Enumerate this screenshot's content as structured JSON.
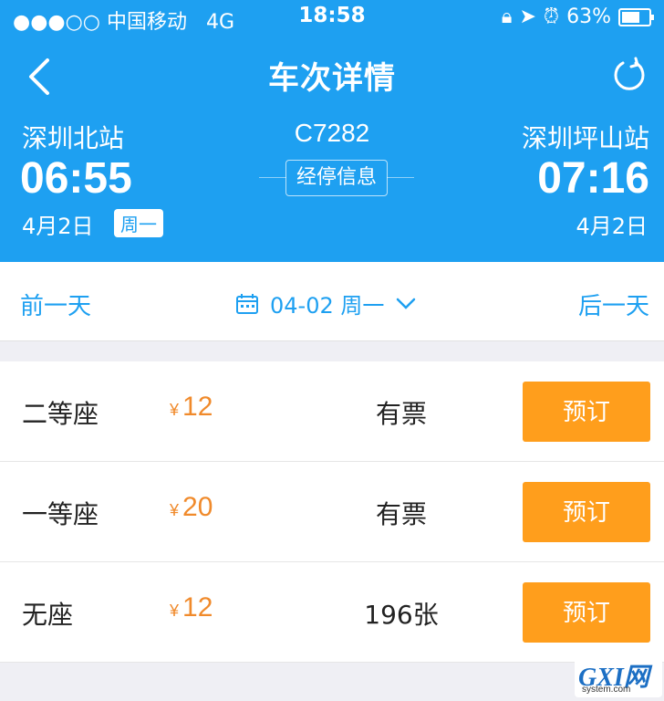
{
  "status_bar": {
    "carrier": "●●●○○ 中国移动",
    "network": "4G",
    "time": "18:58",
    "battery": "63%"
  },
  "nav": {
    "title": "车次详情"
  },
  "train": {
    "number": "C7282",
    "stops_label": "经停信息",
    "from": {
      "station": "深圳北站",
      "time": "06:55",
      "date": "4月2日",
      "weekday": "周一"
    },
    "to": {
      "station": "深圳坪山站",
      "time": "07:16",
      "date": "4月2日"
    }
  },
  "date_bar": {
    "prev": "前一天",
    "date": "04-02 周一",
    "next": "后一天"
  },
  "seats": [
    {
      "type": "二等座",
      "currency": "¥",
      "price": "12",
      "availability": "有票",
      "action": "预订"
    },
    {
      "type": "一等座",
      "currency": "¥",
      "price": "20",
      "availability": "有票",
      "action": "预订"
    },
    {
      "type": "无座",
      "currency": "¥",
      "price": "12",
      "availability": "196张",
      "action": "预订"
    }
  ],
  "watermark": {
    "logo": "GXI网",
    "domain": "system.com"
  },
  "colors": {
    "primary": "#1ea0f1",
    "price": "#f08a2b",
    "book_button": "#ff9e1c"
  }
}
